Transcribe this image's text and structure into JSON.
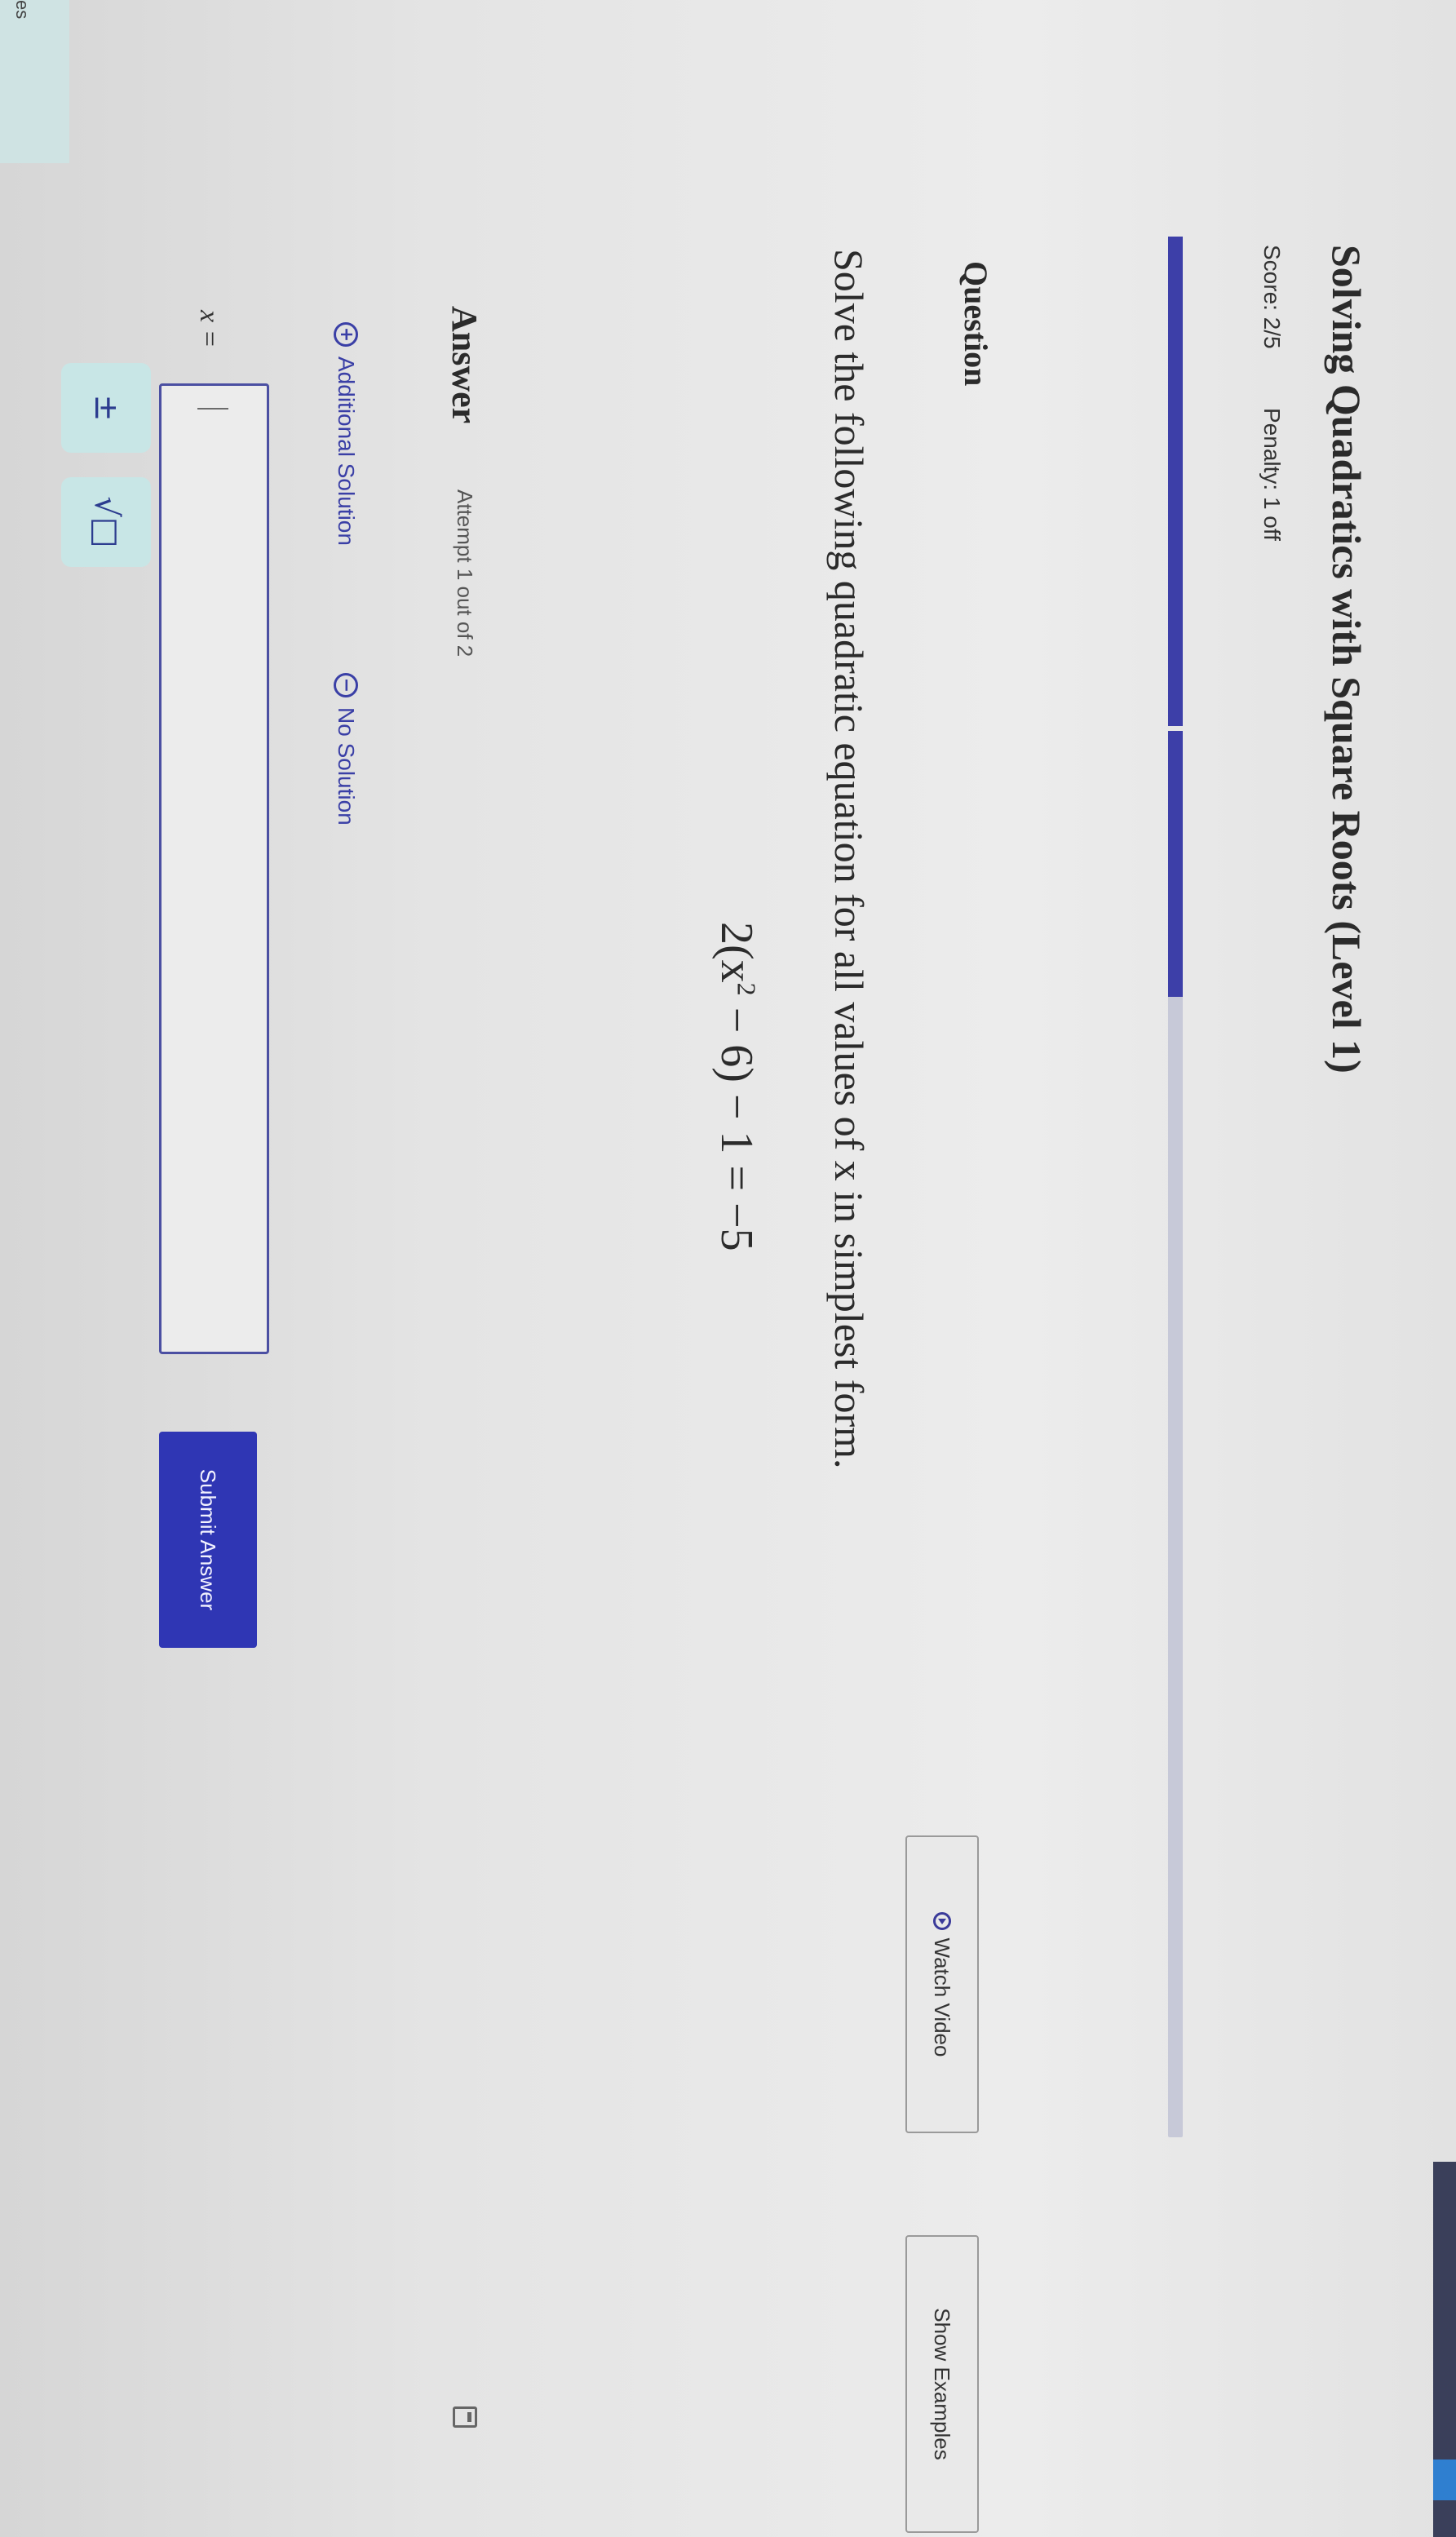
{
  "header": {
    "title": "Solving Quadratics with Square Roots (Level 1)",
    "score_label": "Score: 2/5",
    "penalty_label": "Penalty: 1 off"
  },
  "progress": {
    "fraction": 0.4
  },
  "question": {
    "heading": "Question",
    "watch_video_label": "Watch Video",
    "show_examples_label": "Show Examples",
    "prompt": "Solve the following quadratic equation for all values of x in simplest form.",
    "equation_left": "2(x",
    "equation_exponent": "2",
    "equation_right": " − 6) − 1 = −5"
  },
  "answer": {
    "heading": "Answer",
    "attempt_label": "Attempt 1 out of 2",
    "additional_solution_label": "Additional Solution",
    "no_solution_label": "No Solution",
    "variable_label": "x =",
    "input_value": "",
    "submit_label": "Submit Answer",
    "plus_minus_key": "±",
    "sqrt_key": "√□"
  },
  "edge": {
    "left_label": "es"
  },
  "colors": {
    "accent": "#2f36b4",
    "progress": "#3d3fa8",
    "key_bg": "#c8e6e6",
    "link": "#3a3fa6"
  },
  "icons": [
    "play-icon",
    "calculator-icon",
    "plus-circle-icon",
    "minus-circle-icon"
  ]
}
